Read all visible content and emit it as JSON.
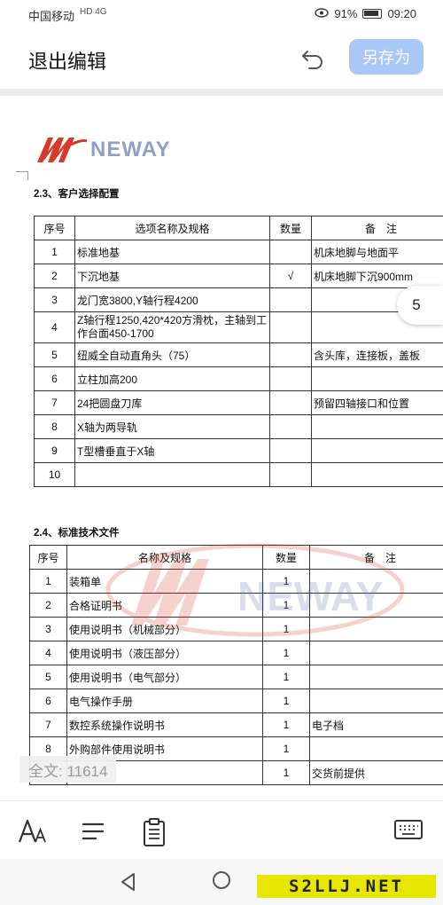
{
  "status_bar": {
    "carrier": "中国移动",
    "signal_tags": "HD 4G",
    "battery": "91%",
    "time": "09:20"
  },
  "app_bar": {
    "exit_label": "退出编辑",
    "save_as_label": "另存为"
  },
  "doc": {
    "logo_text": "NEWAY",
    "section1_title": "2.3、客户选择配置",
    "table1": {
      "headers": [
        "序号",
        "选项名称及规格",
        "数量",
        "备　注"
      ],
      "rows": [
        [
          "1",
          "标准地基",
          "",
          "机床地脚与地面平"
        ],
        [
          "2",
          "下沉地基",
          "√",
          "机床地脚下沉900mm"
        ],
        [
          "3",
          "龙门宽3800,Y轴行程4200",
          "",
          ""
        ],
        [
          "4",
          "Z轴行程1250,420*420方滑枕，主轴到工作台面450-1700",
          "",
          ""
        ],
        [
          "5",
          "纽威全自动直角头（75）",
          "",
          "含头库，连接板，盖板"
        ],
        [
          "6",
          "立柱加高200",
          "",
          ""
        ],
        [
          "7",
          "24把圆盘刀库",
          "",
          "预留四轴接口和位置"
        ],
        [
          "8",
          "X轴为两导轨",
          "",
          ""
        ],
        [
          "9",
          "T型槽垂直于X轴",
          "",
          ""
        ],
        [
          "10",
          "",
          "",
          ""
        ]
      ]
    },
    "section2_title": "2.4、标准技术文件",
    "table2": {
      "headers": [
        "序号",
        "名称及规格",
        "数量",
        "备　注"
      ],
      "rows": [
        [
          "1",
          "装箱单",
          "1",
          ""
        ],
        [
          "2",
          "合格证明书",
          "1",
          ""
        ],
        [
          "3",
          "使用说明书（机械部分）",
          "1",
          ""
        ],
        [
          "4",
          "使用说明书（液压部分）",
          "1",
          ""
        ],
        [
          "5",
          "使用说明书（电气部分）",
          "1",
          ""
        ],
        [
          "6",
          "电气操作手册",
          "1",
          ""
        ],
        [
          "7",
          "数控系统操作说明书",
          "1",
          "电子档"
        ],
        [
          "8",
          "外购部件使用说明书",
          "1",
          ""
        ],
        [
          "",
          "形图",
          "1",
          "交货前提供"
        ]
      ]
    },
    "page_number": "5",
    "word_count": "全文: 11614"
  },
  "watermark_site": "S2LLJ.NET"
}
